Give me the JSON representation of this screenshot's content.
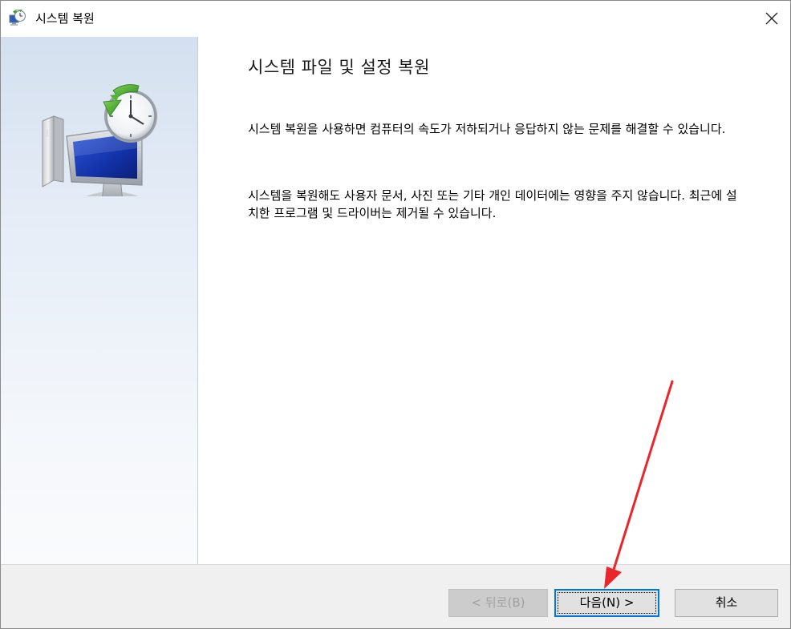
{
  "window": {
    "title": "시스템 복원"
  },
  "content": {
    "heading": "시스템 파일 및 설정 복원",
    "paragraph1": "시스템 복원을 사용하면 컴퓨터의 속도가 저하되거나 응답하지 않는 문제를 해결할 수 있습니다.",
    "paragraph2": "시스템을 복원해도 사용자 문서, 사진 또는 기타 개인 데이터에는 영향을 주지 않습니다. 최근에 설치한 프로그램 및 드라이버는 제거될 수 있습니다."
  },
  "buttons": {
    "back_label": "< 뒤로(B)",
    "next_label": "다음(N) >",
    "cancel_label": "취소"
  },
  "icons": {
    "title": "system-restore-icon",
    "close": "close-icon",
    "hero": "system-restore-computer-clock-icon",
    "annotation": "red-arrow-pointer-icon"
  },
  "colors": {
    "accent_focus": "#0078d7",
    "annotation_arrow": "#e8262c",
    "panel_gradient_top": "#d4e0ef",
    "panel_gradient_bottom": "#fafbfd"
  }
}
